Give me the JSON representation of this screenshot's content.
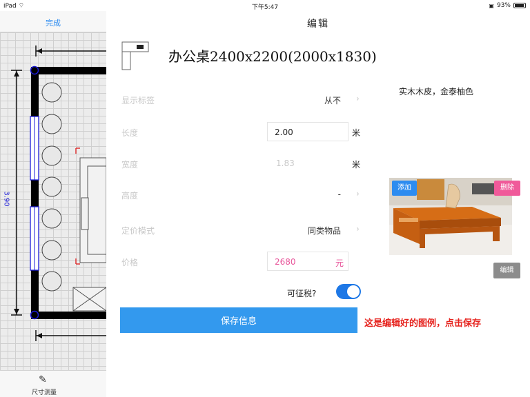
{
  "status": {
    "device": "iPad",
    "time": "下午5:47",
    "battery": "93%"
  },
  "left_panel": {
    "done_label": "完成",
    "dimension_label": "3.90",
    "tool_label": "尺寸测量"
  },
  "header": {
    "title": "编辑"
  },
  "product": {
    "title": "办公桌2400x2200(2000x1830)",
    "description": "实木木皮，金泰柚色"
  },
  "form": {
    "show_label": {
      "label": "显示标签",
      "value": "从不"
    },
    "length": {
      "label": "长度",
      "value": "2.00",
      "unit": "米"
    },
    "width": {
      "label": "宽度",
      "value": "1.83",
      "unit": "米"
    },
    "height": {
      "label": "高度",
      "value": "-"
    },
    "pricing_mode": {
      "label": "定价模式",
      "value": "同类物品"
    },
    "price": {
      "label": "价格",
      "value": "2680",
      "unit": "元"
    },
    "taxable": {
      "label": "可征税?",
      "on": true
    }
  },
  "image_actions": {
    "add": "添加",
    "delete": "删除",
    "edit": "编辑"
  },
  "save_button": "保存信息",
  "annotation": "这是编辑好的图例，点击保存",
  "colors": {
    "accent": "#2d8cf0",
    "save": "#3399ee",
    "delete": "#f05a9a",
    "price": "#e8559a",
    "annotation": "#e6231e"
  }
}
